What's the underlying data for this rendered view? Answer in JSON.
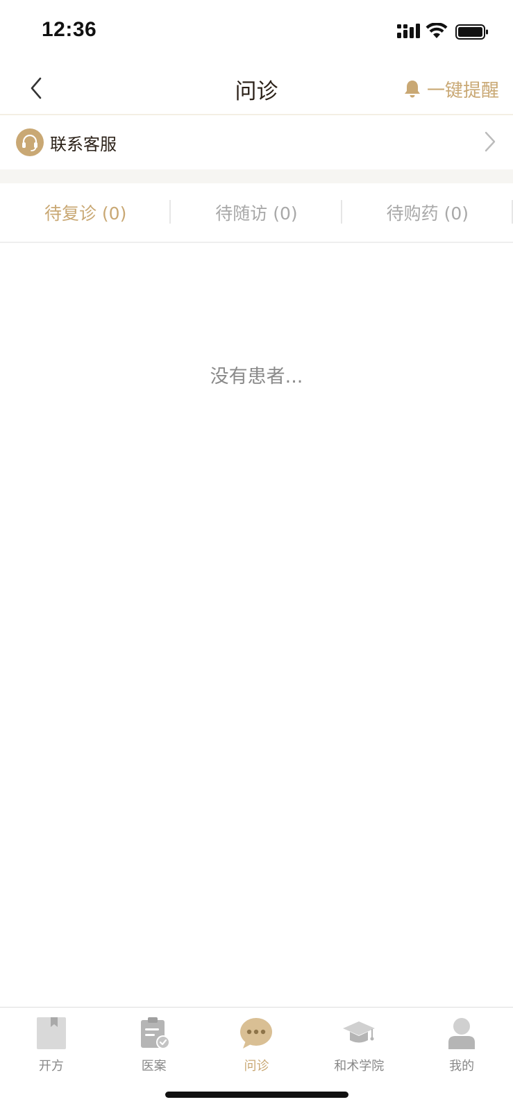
{
  "status_bar": {
    "time": "12:36"
  },
  "nav": {
    "title": "问诊",
    "remind_label": "一键提醒"
  },
  "service": {
    "label": "联系客服"
  },
  "tabs": [
    {
      "label": "待复诊 (0)",
      "active": true
    },
    {
      "label": "待随访 (0)",
      "active": false
    },
    {
      "label": "待购药 (0)",
      "active": false
    }
  ],
  "empty_state": {
    "text": "没有患者..."
  },
  "tabbar": {
    "items": [
      {
        "label": "开方",
        "icon": "prescription-icon",
        "active": false
      },
      {
        "label": "医案",
        "icon": "case-clipboard-icon",
        "active": false
      },
      {
        "label": "问诊",
        "icon": "chat-bubble-icon",
        "active": true
      },
      {
        "label": "和术学院",
        "icon": "graduation-cap-icon",
        "active": false
      },
      {
        "label": "我的",
        "icon": "profile-icon",
        "active": false
      }
    ]
  },
  "colors": {
    "accent": "#c9a874",
    "text_dark": "#2b2118",
    "text_muted": "#a8a8a8",
    "tabbar_muted": "#888888",
    "icon_gray": "#b5b5b5"
  }
}
